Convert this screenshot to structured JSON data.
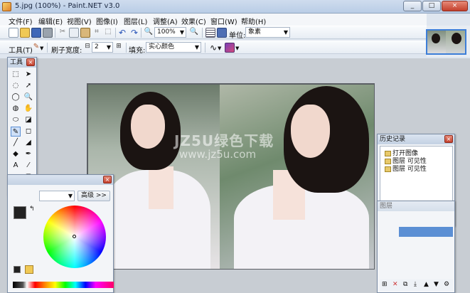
{
  "window": {
    "title": "5.jpg (100%) - Paint.NET v3.0",
    "controls": [
      "_",
      "□",
      "×"
    ]
  },
  "menu": [
    "文件(F)",
    "编辑(E)",
    "视图(V)",
    "图像(I)",
    "图层(L)",
    "调整(A)",
    "效果(C)",
    "窗口(W)",
    "帮助(H)"
  ],
  "toolbar1": {
    "zoom": "100%",
    "unit_label": "单位:",
    "unit_value": "象素"
  },
  "toolbar2": {
    "tool_label": "工具(T)",
    "brush_label": "刷子宽度:",
    "brush_value": "2",
    "fill_label": "填充:",
    "fill_value": "实心颜色"
  },
  "tools_panel": {
    "title": "工具",
    "glyphs": [
      "⬚",
      "➤",
      "◌",
      "➚",
      "◯",
      "🔍",
      "◍",
      "✋",
      "⬭",
      "◪",
      "✎",
      "◻",
      "╱",
      "◢",
      "◆",
      "✒",
      "A",
      "⁄",
      "▭",
      "▢",
      "⬬",
      "☁"
    ]
  },
  "history_panel": {
    "title": "历史记录",
    "items": [
      "打开图像",
      "图层 可见性",
      "图层 可见性"
    ]
  },
  "layers_panel": {
    "title": "图层"
  },
  "colors_panel": {
    "more_button": "高级 >>"
  },
  "watermark": {
    "line1": "JZ5U绿色下载",
    "line2": "www.jz5u.com"
  }
}
